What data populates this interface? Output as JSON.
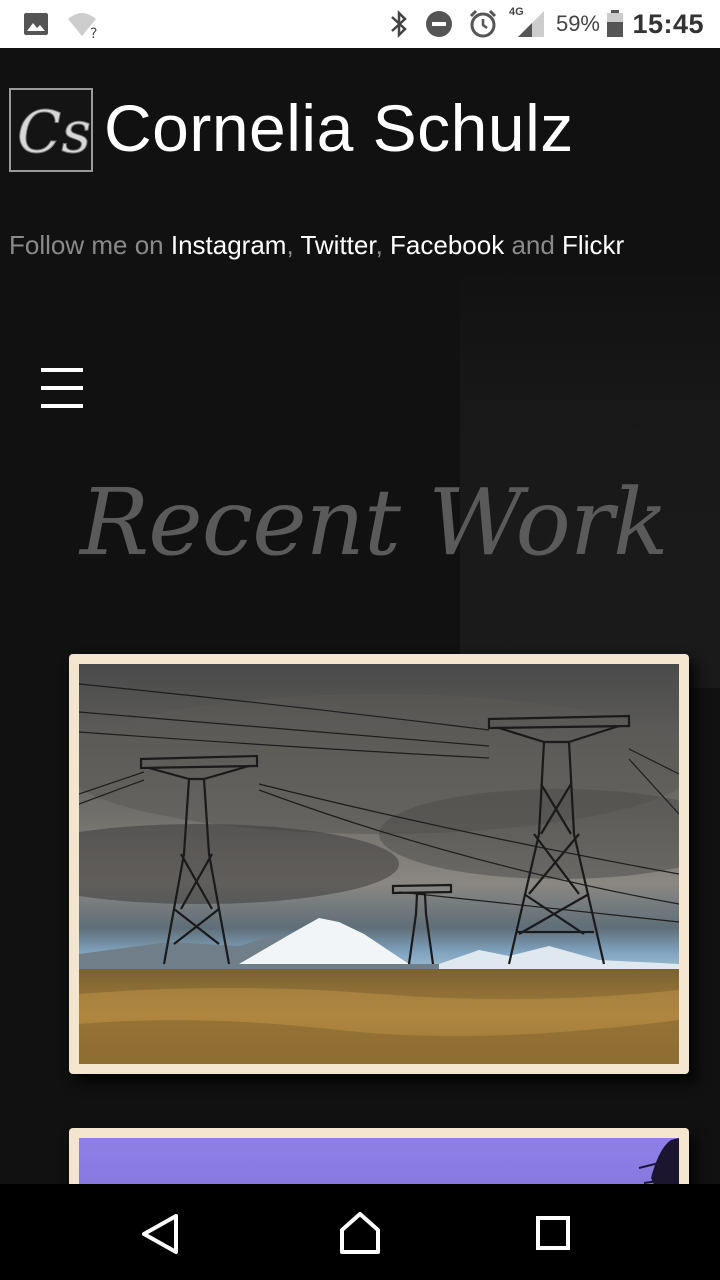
{
  "status_bar": {
    "battery_percent": "59%",
    "time": "15:45",
    "network_type": "4G",
    "icons": [
      "image-notification-icon",
      "wifi-question-icon",
      "bluetooth-icon",
      "do-not-disturb-icon",
      "alarm-icon",
      "signal-icon",
      "battery-icon"
    ]
  },
  "header": {
    "logo_text": "Cs",
    "site_title": "Cornelia Schulz"
  },
  "follow": {
    "prefix": "Follow me on ",
    "links": [
      "Instagram",
      "Twitter",
      "Facebook",
      "Flickr"
    ],
    "separator": ", ",
    "conjunction": " and "
  },
  "menu": {
    "icon": "hamburger-menu-icon"
  },
  "section": {
    "title": "Recent Work"
  },
  "gallery": {
    "items": [
      {
        "subject": "power pylons with snow-capped volcano and golden grassland"
      },
      {
        "subject": "purple sky with tree silhouette"
      }
    ],
    "frame_color": "#f4e5cf"
  },
  "nav_bar": {
    "icons": [
      "back-icon",
      "home-icon",
      "recents-icon"
    ]
  }
}
